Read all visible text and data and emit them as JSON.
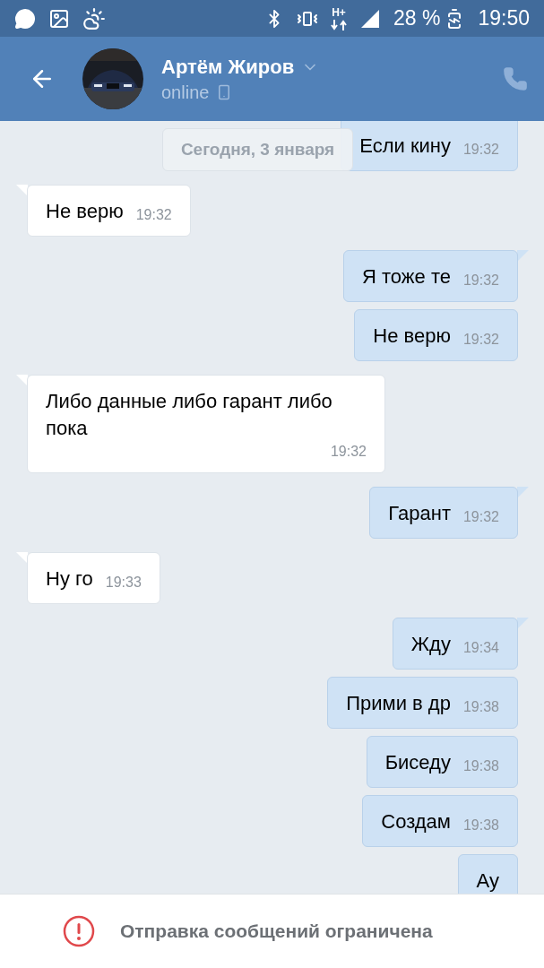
{
  "status_bar": {
    "network": "H+",
    "battery": "28 %",
    "time": "19:50"
  },
  "header": {
    "name": "Артём Жиров",
    "status": "online"
  },
  "date_label": "Сегодня, 3 января",
  "messages": [
    {
      "kind": "out",
      "text": "Если кину",
      "time": "19:32"
    },
    {
      "kind": "in",
      "text": "Не верю",
      "time": "19:32"
    },
    {
      "kind": "out",
      "text": "Я тоже те",
      "time": "19:32"
    },
    {
      "kind": "out",
      "text": "Не верю",
      "time": "19:32"
    },
    {
      "kind": "in",
      "text": "Либо данные либо гарант либо пока",
      "time": "19:32"
    },
    {
      "kind": "out",
      "text": "Гарант",
      "time": "19:32"
    },
    {
      "kind": "in",
      "text": "Ну го",
      "time": "19:33"
    },
    {
      "kind": "out",
      "text": "Жду",
      "time": "19:34"
    },
    {
      "kind": "out",
      "text": "Прими в др",
      "time": "19:38"
    },
    {
      "kind": "out",
      "text": "Биседу",
      "time": "19:38"
    },
    {
      "kind": "out",
      "text": "Создам",
      "time": "19:38"
    },
    {
      "kind": "out",
      "text": "Ау"
    }
  ],
  "notice": "Отправка сообщений ограничена"
}
